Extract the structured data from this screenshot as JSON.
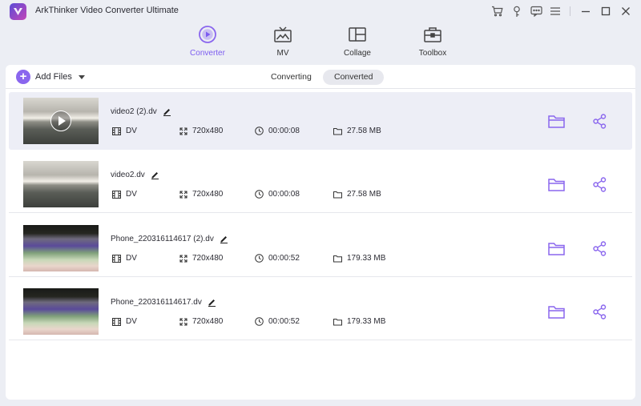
{
  "app": {
    "title": "ArkThinker Video Converter Ultimate"
  },
  "colors": {
    "accent": "#7c5cf0",
    "selected_row": "#edeef6",
    "background": "#eceef4"
  },
  "titlebar_icons": [
    "cart-icon",
    "key-icon",
    "feedback-icon",
    "menu-icon",
    "minimize-icon",
    "maximize-icon",
    "close-icon"
  ],
  "nav": {
    "tabs": [
      {
        "label": "Converter",
        "icon": "converter-icon",
        "active": true
      },
      {
        "label": "MV",
        "icon": "mv-icon",
        "active": false
      },
      {
        "label": "Collage",
        "icon": "collage-icon",
        "active": false
      },
      {
        "label": "Toolbox",
        "icon": "toolbox-icon",
        "active": false
      }
    ]
  },
  "toolbar": {
    "add_files_label": "Add Files",
    "segments": [
      {
        "label": "Converting",
        "active": false
      },
      {
        "label": "Converted",
        "active": true
      }
    ]
  },
  "files": [
    {
      "name": "video2 (2).dv",
      "format": "DV",
      "resolution": "720x480",
      "duration": "00:00:08",
      "size": "27.58 MB",
      "selected": true
    },
    {
      "name": "video2.dv",
      "format": "DV",
      "resolution": "720x480",
      "duration": "00:00:08",
      "size": "27.58 MB",
      "selected": false
    },
    {
      "name": "Phone_220316114617 (2).dv",
      "format": "DV",
      "resolution": "720x480",
      "duration": "00:00:52",
      "size": "179.33 MB",
      "selected": false
    },
    {
      "name": "Phone_220316114617.dv",
      "format": "DV",
      "resolution": "720x480",
      "duration": "00:00:52",
      "size": "179.33 MB",
      "selected": false
    }
  ]
}
